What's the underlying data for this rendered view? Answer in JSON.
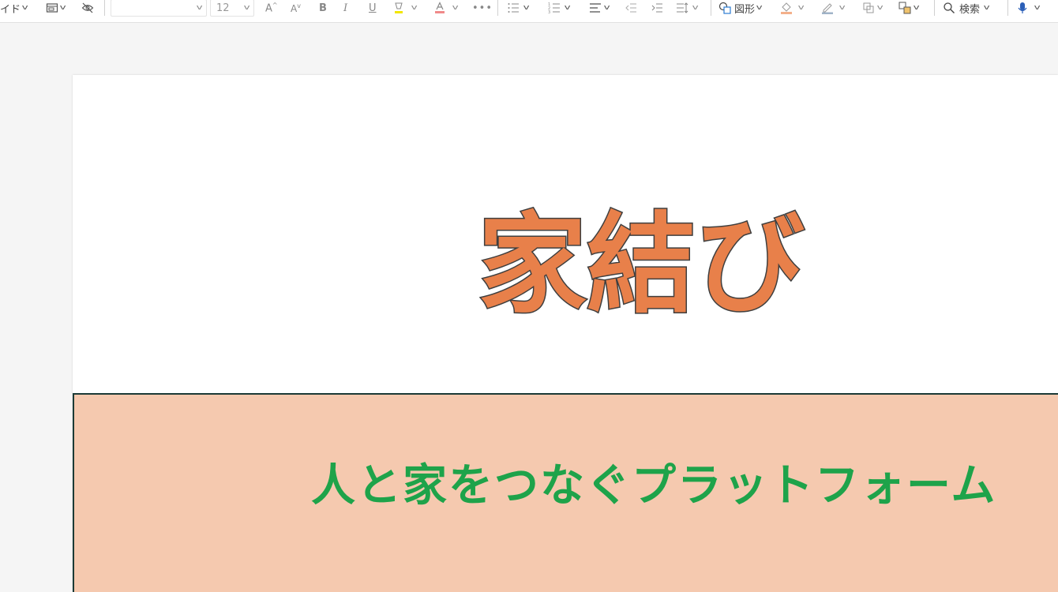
{
  "toolbar": {
    "layout_label": "イド",
    "font_size": "12",
    "shapes_label": "図形",
    "search_label": "検索"
  },
  "slide": {
    "title": "家結び",
    "subtitle": "人と家をつなぐプラットフォーム"
  },
  "colors": {
    "title_fill": "#e8804a",
    "title_outline": "#3f3f3f",
    "subtitle": "#1ea34a",
    "band": "#f5c9af",
    "band_border": "#1b3a36"
  }
}
